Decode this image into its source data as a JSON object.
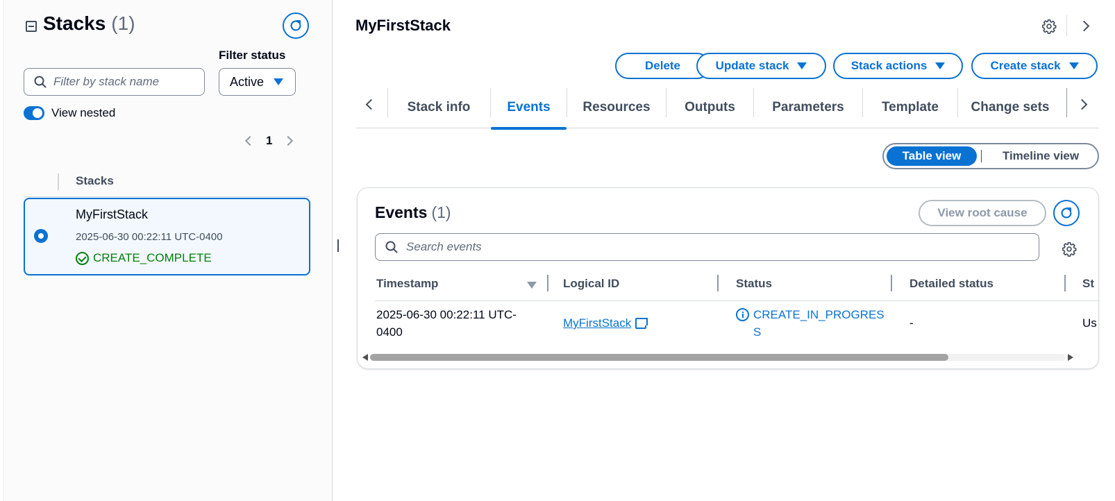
{
  "sidebar": {
    "title": "Stacks",
    "count": "(1)",
    "filter_status_label": "Filter status",
    "search_placeholder": "Filter by stack name",
    "status_select_value": "Active",
    "view_nested_label": "View nested",
    "view_nested_on": true,
    "page_number": "1",
    "column_header": "Stacks",
    "stacks": [
      {
        "name": "MyFirstStack",
        "timestamp": "2025-06-30 00:22:11 UTC-0400",
        "status": "CREATE_COMPLETE",
        "selected": true
      }
    ]
  },
  "main": {
    "title": "MyFirstStack",
    "actions": {
      "delete": "Delete",
      "update_stack": "Update stack",
      "stack_actions": "Stack actions",
      "create_stack": "Create stack"
    },
    "tabs": [
      {
        "label": "Stack info",
        "active": false
      },
      {
        "label": "Events",
        "active": true
      },
      {
        "label": "Resources",
        "active": false
      },
      {
        "label": "Outputs",
        "active": false
      },
      {
        "label": "Parameters",
        "active": false
      },
      {
        "label": "Template",
        "active": false
      },
      {
        "label": "Change sets",
        "active": false
      }
    ],
    "view_toggle": {
      "table": "Table view",
      "timeline": "Timeline view",
      "active": "Table view"
    },
    "events": {
      "title": "Events",
      "count": "(1)",
      "view_root_cause": "View root cause",
      "search_placeholder": "Search events",
      "columns": [
        "Timestamp",
        "Logical ID",
        "Status",
        "Detailed status",
        "St"
      ],
      "rows": [
        {
          "timestamp_line1": "2025-06-30 00:22:11 UTC-",
          "timestamp_line2": "0400",
          "logical_id": "MyFirstStack",
          "status_line1": "CREATE_IN_PROGRES",
          "status_line2": "S",
          "detailed_status": "-",
          "status_reason": "Us"
        }
      ]
    }
  },
  "colors": {
    "accent": "#0972d3",
    "success": "#037f0c",
    "text": "#000716",
    "muted": "#414d5c"
  }
}
